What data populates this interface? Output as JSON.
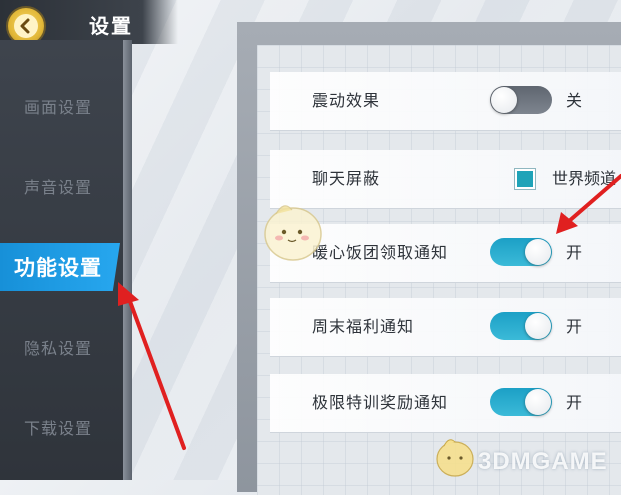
{
  "header": {
    "title": "设置",
    "back_icon": "back-arrow-icon"
  },
  "sidebar": {
    "items": [
      {
        "label": "画面设置"
      },
      {
        "label": "声音设置"
      },
      {
        "label": "功能设置",
        "active": true
      },
      {
        "label": "隐私设置"
      },
      {
        "label": "下载设置"
      }
    ]
  },
  "settings": {
    "rows": [
      {
        "label": "震动效果",
        "type": "toggle",
        "on": false,
        "state_text": "关"
      },
      {
        "label": "聊天屏蔽",
        "type": "checkbox",
        "checked": true,
        "option_text": "世界频道"
      },
      {
        "label": "暖心饭团领取通知",
        "type": "toggle",
        "on": true,
        "state_text": "开"
      },
      {
        "label": "周末福利通知",
        "type": "toggle",
        "on": true,
        "state_text": "开"
      },
      {
        "label": "极限特训奖励通知",
        "type": "toggle",
        "on": true,
        "state_text": "开"
      }
    ]
  },
  "watermark": {
    "text": "3DMGAME"
  },
  "colors": {
    "accent": "#1790d8",
    "toggle_on": "#1ca0c6",
    "toggle_off": "#5f6670",
    "annotation_arrow": "#e02020"
  }
}
